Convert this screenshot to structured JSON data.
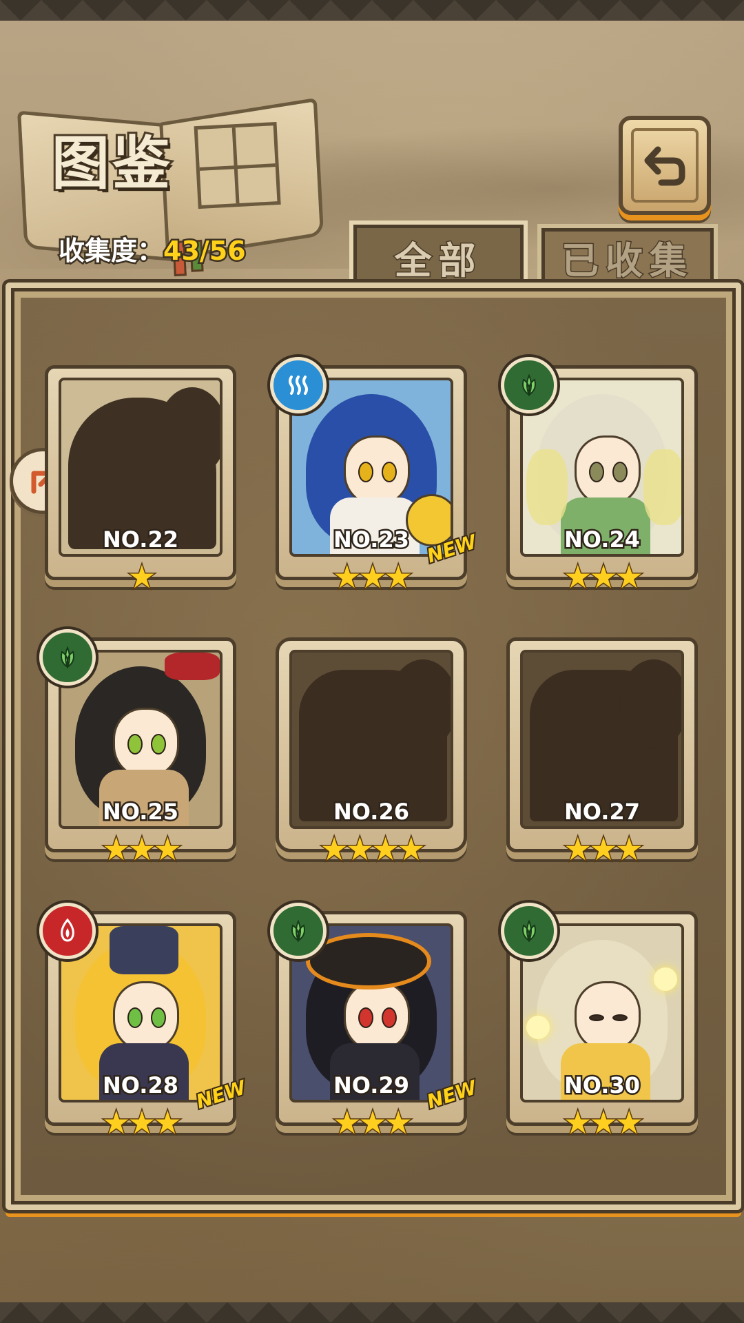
{
  "header": {
    "title": "图鉴",
    "collection_label": "收集度：",
    "collection_value": "43/56"
  },
  "tabs": [
    {
      "label": "全部",
      "active": true
    },
    {
      "label": "已收集",
      "active": false
    }
  ],
  "icons": {
    "back": "back-arrow-icon",
    "scroll": "arrow-icon"
  },
  "colors": {
    "accent": "#e9931f",
    "star": "#ffcf1f",
    "water": "#2b8fd6",
    "leaf": "#2f6b33",
    "fire": "#c8272a"
  },
  "cards": [
    {
      "number": "NO.22",
      "stars": "★",
      "element": null,
      "new": false,
      "locked": true
    },
    {
      "number": "NO.23",
      "stars": "★★★",
      "element": "water",
      "new": true,
      "new_label": "NEW",
      "locked": false
    },
    {
      "number": "NO.24",
      "stars": "★★★",
      "element": "leaf",
      "new": false,
      "locked": false
    },
    {
      "number": "NO.25",
      "stars": "★★★",
      "element": "leaf",
      "new": false,
      "locked": false
    },
    {
      "number": "NO.26",
      "stars": "★★★★",
      "element": null,
      "new": false,
      "locked": true
    },
    {
      "number": "NO.27",
      "stars": "★★★",
      "element": null,
      "new": false,
      "locked": true
    },
    {
      "number": "NO.28",
      "stars": "★★★",
      "element": "fire",
      "new": true,
      "new_label": "NEW",
      "locked": false
    },
    {
      "number": "NO.29",
      "stars": "★★★",
      "element": "leaf",
      "new": true,
      "new_label": "NEW",
      "locked": false
    },
    {
      "number": "NO.30",
      "stars": "★★★",
      "element": "leaf",
      "new": false,
      "locked": false
    }
  ]
}
